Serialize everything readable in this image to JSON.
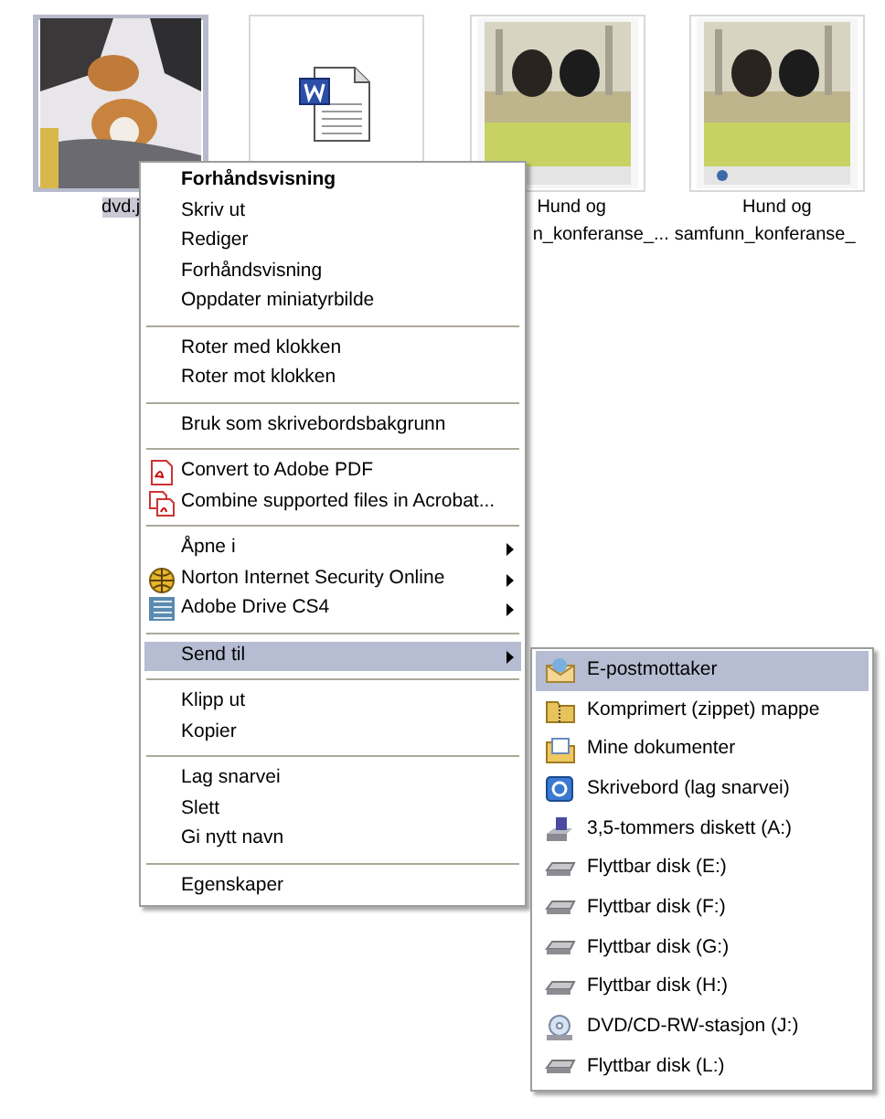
{
  "files": [
    {
      "kind": "picture",
      "selected": true,
      "label_lines": [
        "dvd.j"
      ]
    },
    {
      "kind": "document",
      "selected": false
    },
    {
      "kind": "picture",
      "selected": false,
      "label_lines": [
        "Hund og",
        "n_konferanse_..."
      ]
    },
    {
      "kind": "picture",
      "selected": false,
      "label_lines": [
        "Hund og",
        "samfunn_konferanse_"
      ]
    }
  ],
  "context_menu": [
    {
      "kind": "item",
      "label": "Forhåndsvisning",
      "bold": true,
      "selected": false
    },
    {
      "kind": "item",
      "label": "Skriv ut",
      "selected": false
    },
    {
      "kind": "item",
      "label": "Rediger",
      "selected": false
    },
    {
      "kind": "item",
      "label": "Forhåndsvisning",
      "selected": false
    },
    {
      "kind": "item",
      "label": "Oppdater miniatyrbilde",
      "selected": false
    },
    {
      "kind": "separator"
    },
    {
      "kind": "item",
      "label": "Roter med klokken",
      "selected": false
    },
    {
      "kind": "item",
      "label": "Roter mot klokken",
      "selected": false
    },
    {
      "kind": "separator"
    },
    {
      "kind": "item",
      "label": "Bruk som skrivebordsbakgrunn",
      "selected": false
    },
    {
      "kind": "separator"
    },
    {
      "kind": "item",
      "label": "Convert to Adobe PDF",
      "selected": false
    },
    {
      "kind": "item",
      "label": "Combine supported files in Acrobat...",
      "selected": false
    },
    {
      "kind": "separator"
    },
    {
      "kind": "item",
      "label": "Åpne i",
      "submenu": true,
      "selected": false
    },
    {
      "kind": "item",
      "label": "Norton Internet Security Online",
      "submenu": true,
      "selected": false
    },
    {
      "kind": "item",
      "label": "Adobe Drive CS4",
      "submenu": true,
      "selected": false
    },
    {
      "kind": "separator"
    },
    {
      "kind": "item",
      "label": "Send til",
      "submenu": true,
      "selected": true
    },
    {
      "kind": "separator"
    },
    {
      "kind": "item",
      "label": "Klipp ut",
      "selected": false
    },
    {
      "kind": "item",
      "label": "Kopier",
      "selected": false
    },
    {
      "kind": "separator"
    },
    {
      "kind": "item",
      "label": "Lag snarvei",
      "selected": false
    },
    {
      "kind": "item",
      "label": "Slett",
      "selected": false
    },
    {
      "kind": "item",
      "label": "Gi nytt navn",
      "selected": false
    },
    {
      "kind": "separator"
    },
    {
      "kind": "item",
      "label": "Egenskaper",
      "selected": false
    }
  ],
  "send_to_menu": [
    {
      "label": "E-postmottaker",
      "selected": true
    },
    {
      "label": "Komprimert (zippet) mappe",
      "selected": false
    },
    {
      "label": "Mine dokumenter",
      "selected": false
    },
    {
      "label": "Skrivebord (lag snarvei)",
      "selected": false
    },
    {
      "label": "3,5-tommers diskett (A:)",
      "selected": false
    },
    {
      "label": "Flyttbar disk (E:)",
      "selected": false
    },
    {
      "label": "Flyttbar disk (F:)",
      "selected": false
    },
    {
      "label": "Flyttbar disk (G:)",
      "selected": false
    },
    {
      "label": "Flyttbar disk (H:)",
      "selected": false
    },
    {
      "label": "DVD/CD-RW-stasjon (J:)",
      "selected": false
    },
    {
      "label": "Flyttbar disk (L:)",
      "selected": false
    }
  ]
}
